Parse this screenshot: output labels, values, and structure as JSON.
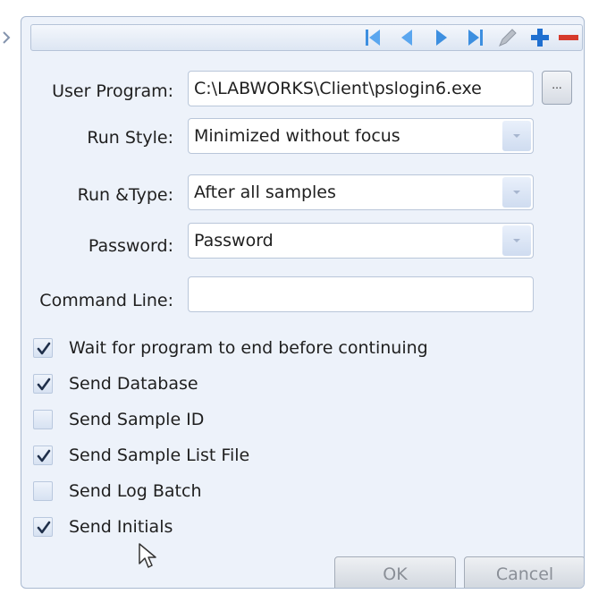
{
  "toolbar": {
    "icons": [
      "first-record-icon",
      "previous-record-icon",
      "next-record-icon",
      "last-record-icon",
      "edit-icon",
      "add-icon",
      "delete-icon"
    ]
  },
  "form": {
    "user_program": {
      "label": "User Program:",
      "value": "C:\\LABWORKS\\Client\\pslogin6.exe",
      "browse_label": "..."
    },
    "run_style": {
      "label": "Run Style:",
      "value": "Minimized without focus"
    },
    "run_type": {
      "label": "Run &Type:",
      "value": "After all samples"
    },
    "password": {
      "label": "Password:",
      "value": "Password"
    },
    "command_line": {
      "label": "Command Line:",
      "value": ""
    }
  },
  "options": [
    {
      "label": "Wait for program to end before continuing",
      "checked": true
    },
    {
      "label": "Send Database",
      "checked": true
    },
    {
      "label": "Send Sample ID",
      "checked": false
    },
    {
      "label": "Send Sample List File",
      "checked": true
    },
    {
      "label": "Send Log Batch",
      "checked": false
    },
    {
      "label": "Send Initials",
      "checked": true
    }
  ],
  "buttons": {
    "ok": "OK",
    "cancel": "Cancel"
  },
  "colors": {
    "nav_blue": "#3d8fe0",
    "add_blue": "#1f6fd0",
    "delete_red": "#d63a2c"
  }
}
